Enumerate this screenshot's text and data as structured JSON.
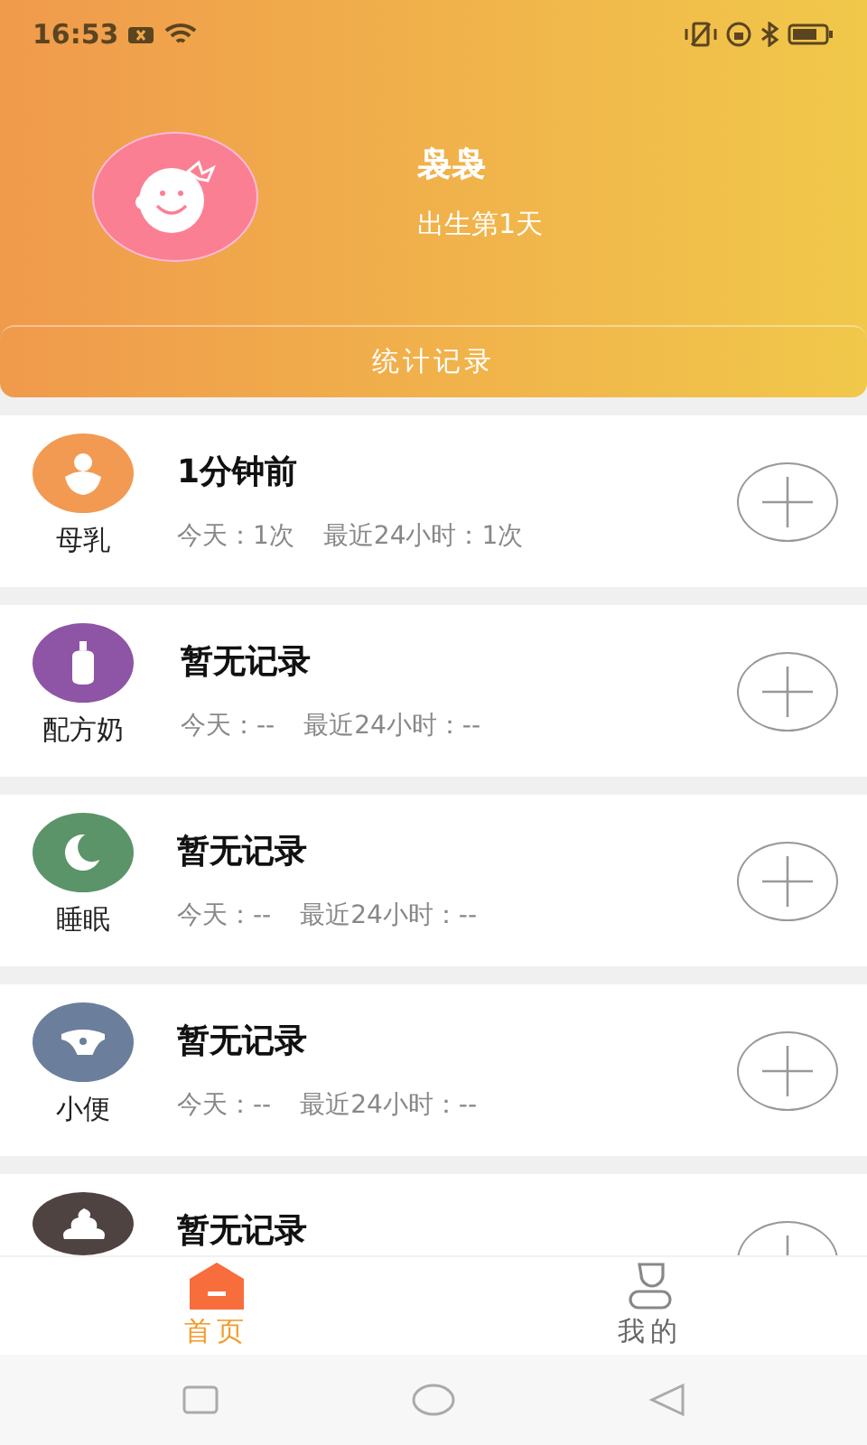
{
  "status_bar": {
    "time": "16:53"
  },
  "profile": {
    "name": "袅袅",
    "age": "出生第1天"
  },
  "stats_button": "统计记录",
  "records": [
    {
      "kind": "breast",
      "color": "#f29a52",
      "label": "母乳",
      "title": "1分钟前",
      "today": "今天：1次",
      "recent": "最近24小时：1次"
    },
    {
      "kind": "bottle",
      "color": "#8e54a5",
      "label": "配方奶",
      "title": "暂无记录",
      "today": "今天：--",
      "recent": "最近24小时：--"
    },
    {
      "kind": "moon",
      "color": "#5b9468",
      "label": "睡眠",
      "title": "暂无记录",
      "today": "今天：--",
      "recent": "最近24小时：--"
    },
    {
      "kind": "diaper",
      "color": "#6b7f9c",
      "label": "小便",
      "title": "暂无记录",
      "today": "今天：--",
      "recent": "最近24小时：--"
    },
    {
      "kind": "poop",
      "color": "#4e4340",
      "title": "暂无记录"
    }
  ],
  "tabs": [
    {
      "label": "首页",
      "kind": "home",
      "selected": true
    },
    {
      "label": "我的",
      "kind": "person",
      "selected": false
    }
  ]
}
